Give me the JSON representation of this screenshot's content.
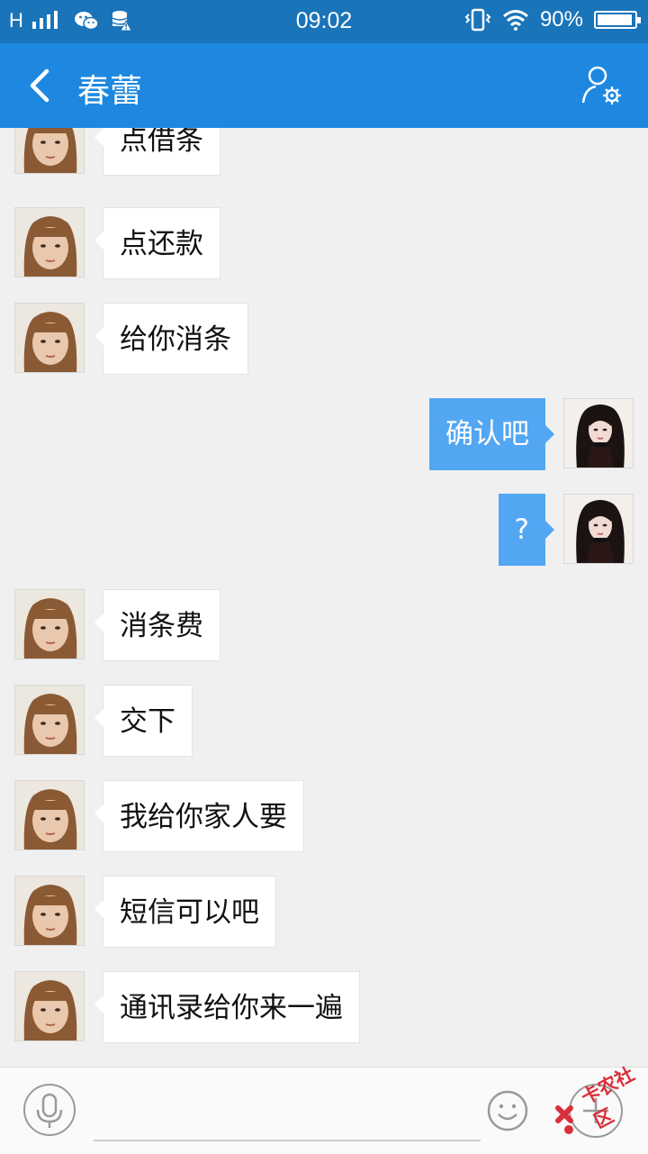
{
  "status_bar": {
    "signal": "H",
    "time": "09:02",
    "battery": "90%",
    "icons": [
      "signal-icon",
      "wechat-icon",
      "data-alert-icon",
      "vibrate-icon",
      "wifi-icon",
      "battery-icon"
    ]
  },
  "header": {
    "title": "春蕾",
    "icons": [
      "back-arrow-icon",
      "contact-settings-icon"
    ]
  },
  "messages": [
    {
      "side": "left",
      "text": "点借条"
    },
    {
      "side": "left",
      "text": "点还款"
    },
    {
      "side": "left",
      "text": "给你消条"
    },
    {
      "side": "right",
      "text": "确认吧"
    },
    {
      "side": "right",
      "text": "?"
    },
    {
      "side": "left",
      "text": "消条费"
    },
    {
      "side": "left",
      "text": "交下"
    },
    {
      "side": "left",
      "text": "我给你家人要"
    },
    {
      "side": "left",
      "text": "短信可以吧"
    },
    {
      "side": "left",
      "text": "通讯录给你来一遍"
    }
  ],
  "bottom_bar": {
    "input_value": "",
    "icons": [
      "microphone-icon",
      "emoji-icon",
      "plus-icon"
    ]
  },
  "watermark": {
    "text": "卡农社区"
  },
  "colors": {
    "status_bar": "#1a74b9",
    "title_bar": "#1e88e0",
    "sent_bubble": "#53a6f2",
    "received_bubble": "#ffffff",
    "background": "#f1f0f1"
  }
}
